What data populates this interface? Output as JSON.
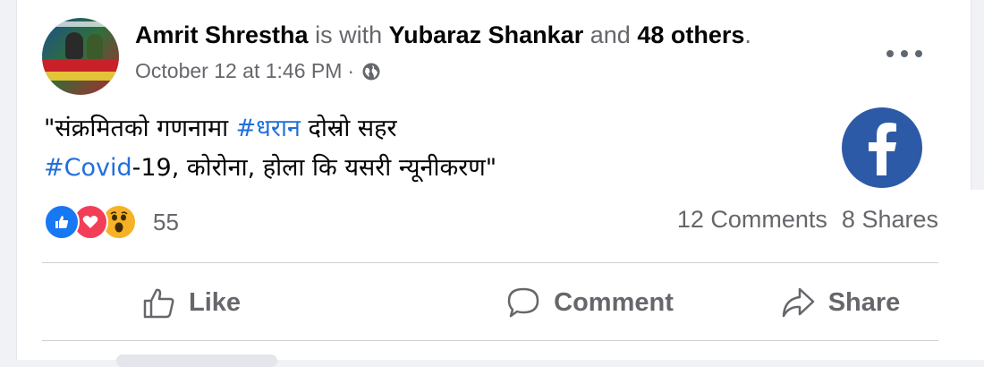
{
  "post": {
    "author": "Amrit Shrestha",
    "with_text": "is with",
    "tagged_person": "Yubaraz Shankar",
    "and_text": "and",
    "others": "48 others",
    "period": ".",
    "timestamp": "October 12 at 1:46 PM",
    "separator": "·",
    "privacy_icon": "globe-icon",
    "more_icon": "more-options-icon",
    "text": {
      "line1_quote_open": "\"",
      "line1_part1": "संक्रमितको गणनामा ",
      "line1_hashtag": "#धरान",
      "line1_part2": " दोस्रो सहर",
      "line2_hashtag": "#Covid",
      "line2_part": "-19, कोरोना, होला कि यसरी न्यूनीकरण",
      "line2_quote_close": "\""
    },
    "logo_icon": "facebook-logo-icon"
  },
  "reactions": {
    "icons": [
      "like-reaction-icon",
      "love-reaction-icon",
      "wow-reaction-icon"
    ],
    "count": "55"
  },
  "stats": {
    "comments": "12 Comments",
    "shares": "8 Shares"
  },
  "actions": {
    "like": "Like",
    "comment": "Comment",
    "share": "Share"
  },
  "colors": {
    "hashtag": "#216fdb",
    "like": "#1877f2",
    "love": "#f33e58",
    "wow": "#f7b125",
    "facebook": "#2d5aa6"
  }
}
